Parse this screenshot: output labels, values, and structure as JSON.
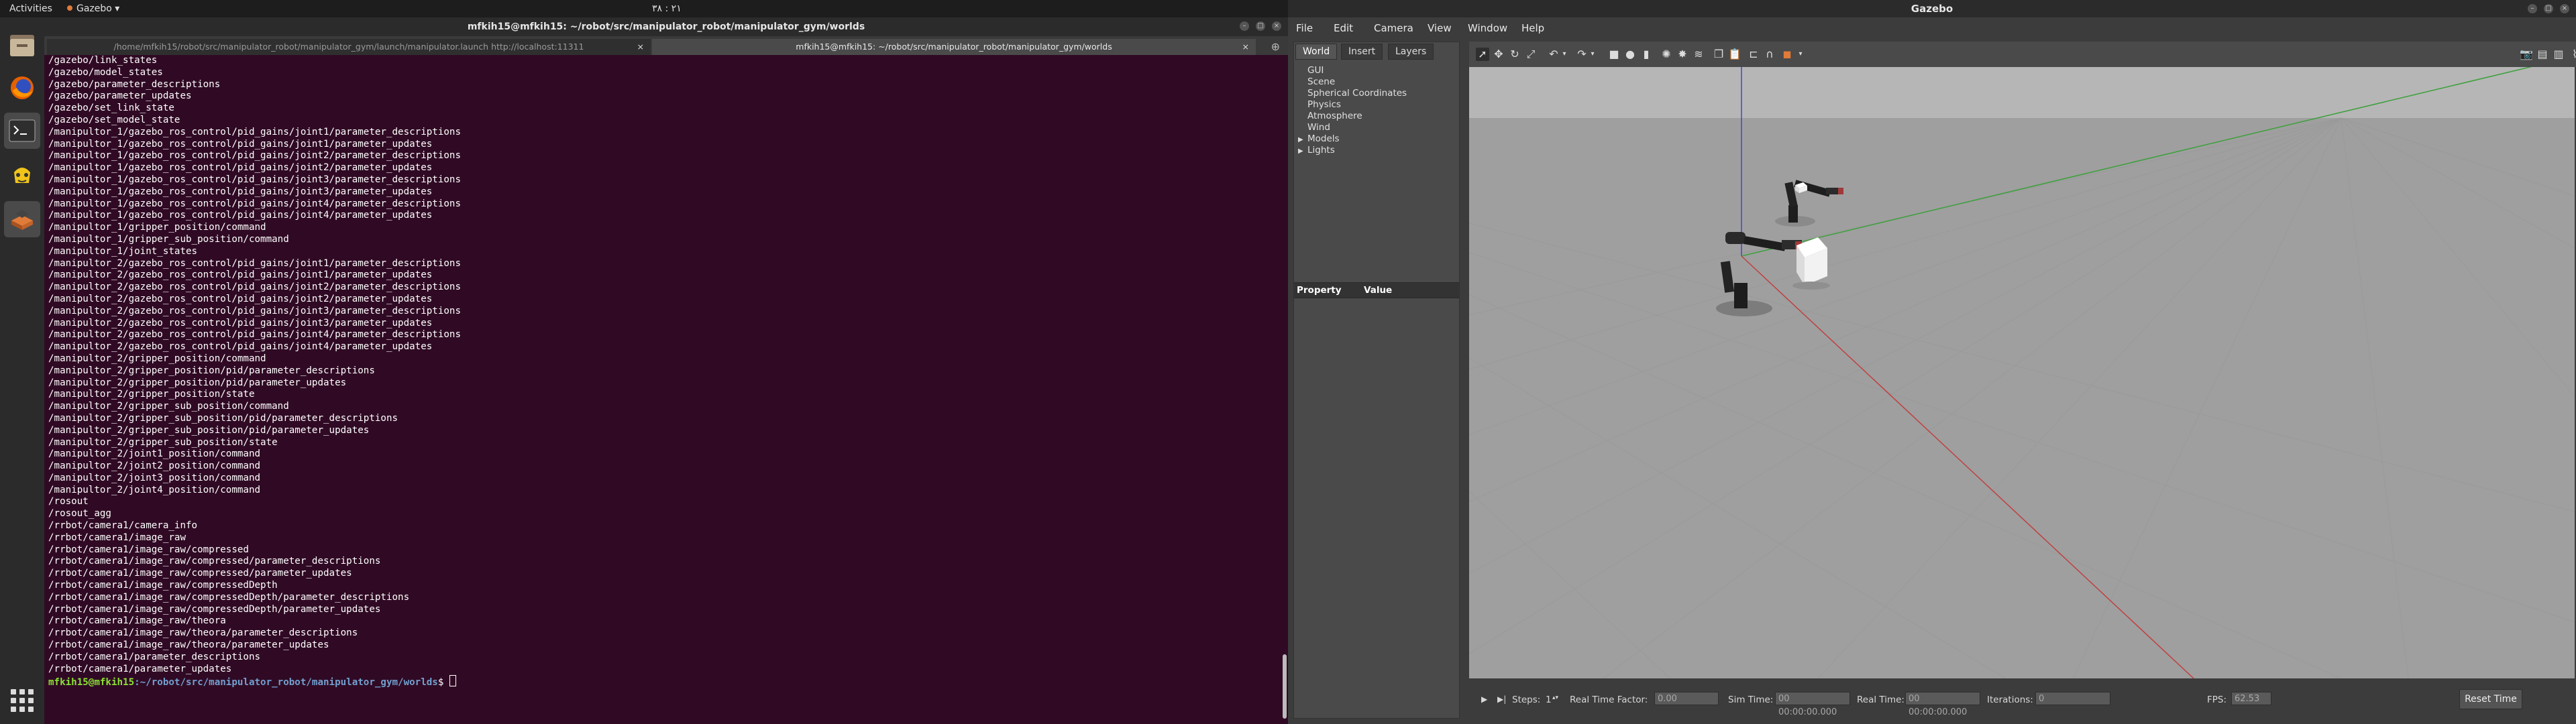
{
  "topbar": {
    "activities": "Activities",
    "app": "Gazebo ▾",
    "clock": "٢١ : ٣٨"
  },
  "dock": {
    "items": [
      "files-icon",
      "firefox-icon",
      "terminal-icon",
      "gazebo-icon",
      "software-installer-icon",
      "show-apps-icon"
    ]
  },
  "terminal": {
    "title": "mfkih15@mfkih15: ~/robot/src/manipulator_robot/manipulator_gym/worlds",
    "tabs": [
      "/home/mfkih15/robot/src/manipulator_robot/manipulator_gym/launch/manipulator.launch http://localhost:11311",
      "mfkih15@mfkih15: ~/robot/src/manipulator_robot/manipulator_gym/worlds"
    ],
    "lines": [
      "/gazebo/link_states",
      "/gazebo/model_states",
      "/gazebo/parameter_descriptions",
      "/gazebo/parameter_updates",
      "/gazebo/set_link_state",
      "/gazebo/set_model_state",
      "/manipultor_1/gazebo_ros_control/pid_gains/joint1/parameter_descriptions",
      "/manipultor_1/gazebo_ros_control/pid_gains/joint1/parameter_updates",
      "/manipultor_1/gazebo_ros_control/pid_gains/joint2/parameter_descriptions",
      "/manipultor_1/gazebo_ros_control/pid_gains/joint2/parameter_updates",
      "/manipultor_1/gazebo_ros_control/pid_gains/joint3/parameter_descriptions",
      "/manipultor_1/gazebo_ros_control/pid_gains/joint3/parameter_updates",
      "/manipultor_1/gazebo_ros_control/pid_gains/joint4/parameter_descriptions",
      "/manipultor_1/gazebo_ros_control/pid_gains/joint4/parameter_updates",
      "/manipultor_1/gripper_position/command",
      "/manipultor_1/gripper_sub_position/command",
      "/manipultor_1/joint_states",
      "/manipultor_2/gazebo_ros_control/pid_gains/joint1/parameter_descriptions",
      "/manipultor_2/gazebo_ros_control/pid_gains/joint1/parameter_updates",
      "/manipultor_2/gazebo_ros_control/pid_gains/joint2/parameter_descriptions",
      "/manipultor_2/gazebo_ros_control/pid_gains/joint2/parameter_updates",
      "/manipultor_2/gazebo_ros_control/pid_gains/joint3/parameter_descriptions",
      "/manipultor_2/gazebo_ros_control/pid_gains/joint3/parameter_updates",
      "/manipultor_2/gazebo_ros_control/pid_gains/joint4/parameter_descriptions",
      "/manipultor_2/gazebo_ros_control/pid_gains/joint4/parameter_updates",
      "/manipultor_2/gripper_position/command",
      "/manipultor_2/gripper_position/pid/parameter_descriptions",
      "/manipultor_2/gripper_position/pid/parameter_updates",
      "/manipultor_2/gripper_position/state",
      "/manipultor_2/gripper_sub_position/command",
      "/manipultor_2/gripper_sub_position/pid/parameter_descriptions",
      "/manipultor_2/gripper_sub_position/pid/parameter_updates",
      "/manipultor_2/gripper_sub_position/state",
      "/manipultor_2/joint1_position/command",
      "/manipultor_2/joint2_position/command",
      "/manipultor_2/joint3_position/command",
      "/manipultor_2/joint4_position/command",
      "/rosout",
      "/rosout_agg",
      "/rrbot/camera1/camera_info",
      "/rrbot/camera1/image_raw",
      "/rrbot/camera1/image_raw/compressed",
      "/rrbot/camera1/image_raw/compressed/parameter_descriptions",
      "/rrbot/camera1/image_raw/compressed/parameter_updates",
      "/rrbot/camera1/image_raw/compressedDepth",
      "/rrbot/camera1/image_raw/compressedDepth/parameter_descriptions",
      "/rrbot/camera1/image_raw/compressedDepth/parameter_updates",
      "/rrbot/camera1/image_raw/theora",
      "/rrbot/camera1/image_raw/theora/parameter_descriptions",
      "/rrbot/camera1/image_raw/theora/parameter_updates",
      "/rrbot/camera1/parameter_descriptions",
      "/rrbot/camera1/parameter_updates"
    ],
    "prompt_user": "mfkih15@mfkih15",
    "prompt_path": ":~/robot/src/manipulator_robot/manipulator_gym/worlds",
    "prompt_symbol": "$ "
  },
  "gazebo": {
    "title": "Gazebo",
    "menu": [
      "File",
      "Edit",
      "Camera",
      "View",
      "Window",
      "Help"
    ],
    "left_tabs": [
      "World",
      "Insert",
      "Layers"
    ],
    "world_items": [
      "GUI",
      "Scene",
      "Spherical Coordinates",
      "Physics",
      "Atmosphere",
      "Wind",
      "Models",
      "Lights"
    ],
    "property_header": "Property",
    "value_header": "Value",
    "bottom": {
      "steps_label": "Steps:",
      "steps_value": "1",
      "rtf_label": "Real Time Factor:",
      "rtf_value": "0.00",
      "sim_time_label": "Sim Time:",
      "sim_time_value": "00 00:00:00.000",
      "real_time_label": "Real Time:",
      "real_time_value": "00 00:00:00.000",
      "iterations_label": "Iterations:",
      "iterations_value": "0",
      "fps_label": "FPS:",
      "fps_value": "62.53",
      "reset_label": "Reset Time"
    },
    "colors": {
      "grid_line": "#9a9a9a",
      "sky": "#b4b4b4",
      "ground": "#9e9e9e",
      "x_axis": "#c04040",
      "y_axis": "#40a040",
      "z_axis": "#4040c0"
    }
  }
}
